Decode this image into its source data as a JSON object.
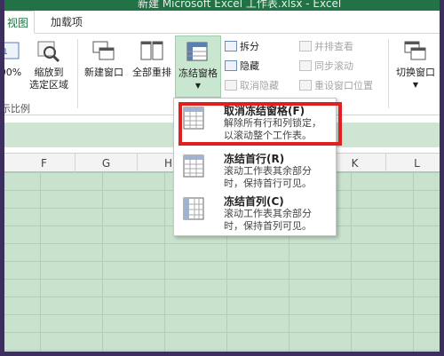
{
  "window": {
    "title": "新建 Microsoft Excel 工作表.xlsx - Excel"
  },
  "tabs": [
    {
      "label": "视图"
    },
    {
      "label": "加载项"
    }
  ],
  "ribbon": {
    "zoom_percent_label": "00%",
    "zoom_to_selection": "缩放到\n选定区域",
    "zoom_to_selection_l1": "缩放到",
    "zoom_to_selection_l2": "选定区域",
    "group_zoom_label": "示比例",
    "new_window": "新建窗口",
    "arrange_all": "全部重排",
    "freeze_panes": "冻结窗格",
    "split": "拆分",
    "hide": "隐藏",
    "unhide": "取消隐藏",
    "view_side_by_side": "并排查看",
    "sync_scroll": "同步滚动",
    "reset_window_pos": "重设窗口位置",
    "switch_windows": "切换窗口"
  },
  "columns": [
    "F",
    "G",
    "H",
    "I",
    "J",
    "K",
    "L"
  ],
  "freeze_menu": {
    "items": [
      {
        "title": "取消冻结窗格(F)",
        "desc1": "解除所有行和列锁定，",
        "desc2": "以滚动整个工作表。"
      },
      {
        "title": "冻结首行(R)",
        "desc1": "滚动工作表其余部分",
        "desc2": "时，保持首行可见。"
      },
      {
        "title": "冻结首列(C)",
        "desc1": "滚动工作表其余部分",
        "desc2": "时，保持首列可见。"
      }
    ]
  },
  "colors": {
    "excel_green": "#217346",
    "highlight_red": "#e02020",
    "selection_green": "#c8e2cd"
  }
}
